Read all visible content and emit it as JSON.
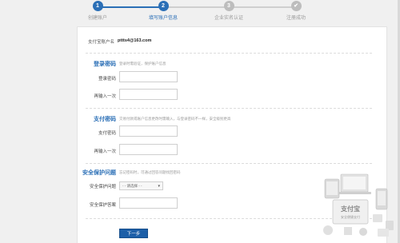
{
  "steps": [
    {
      "num": "1",
      "label": "创建账户",
      "state": "done"
    },
    {
      "num": "2",
      "label": "填写账户信息",
      "state": "current"
    },
    {
      "num": "3",
      "label": "企业实名认证",
      "state": "todo"
    },
    {
      "num": "✔",
      "label": "注册成功",
      "state": "todo"
    }
  ],
  "account": {
    "label": "支付宝账户名",
    "value": "pttts4@163.com"
  },
  "login_section": {
    "title": "登录密码",
    "desc": "登录时需验证，保护账户信息",
    "fields": [
      {
        "label": "登录密码"
      },
      {
        "label": "再输入一次"
      }
    ]
  },
  "pay_section": {
    "title": "支付密码",
    "desc": "交易付款或账户信息更改时需输入，与登录密码不一样，安全级别更高",
    "fields": [
      {
        "label": "支付密码"
      },
      {
        "label": "再输入一次"
      }
    ]
  },
  "security_section": {
    "title": "安全保护问题",
    "desc": "忘记密码时，可通过回答问题找回密码",
    "question_label": "安全保护问题",
    "question_select": "- - 请选择 - -",
    "answer_label": "安全保护答案"
  },
  "next_button": "下一步",
  "illus_text": {
    "brand": "支付宝",
    "sub": "安全便捷支付"
  }
}
